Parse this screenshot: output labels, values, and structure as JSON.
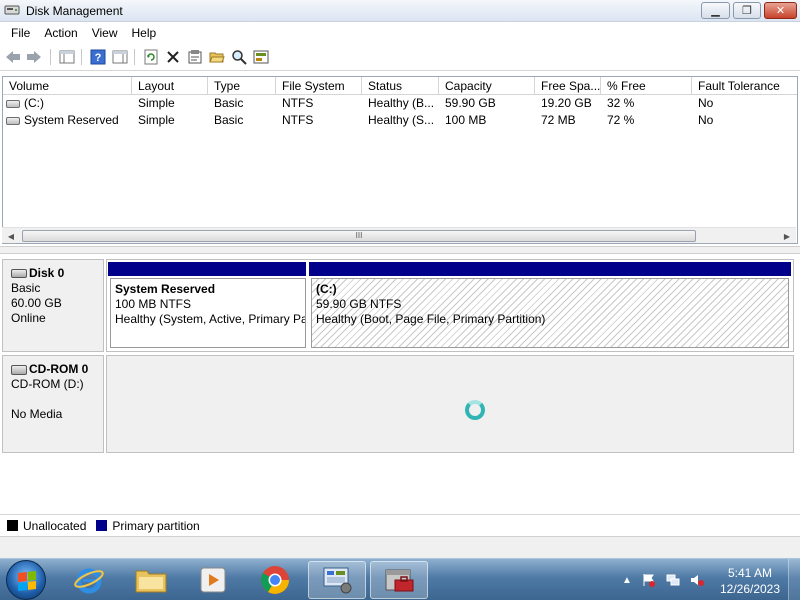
{
  "window": {
    "title": "Disk Management",
    "controls": {
      "minimize": "▁",
      "maximize": "❐",
      "close": "✕"
    }
  },
  "menu": [
    "File",
    "Action",
    "View",
    "Help"
  ],
  "toolbar": {
    "icons": [
      "back-icon",
      "forward-icon",
      "console-tree-icon",
      "help-icon",
      "action-pane-icon",
      "refresh-icon",
      "delete-icon",
      "properties-icon",
      "open-icon",
      "explore-icon",
      "rescan-icon"
    ]
  },
  "volume_list": {
    "columns": [
      "Volume",
      "Layout",
      "Type",
      "File System",
      "Status",
      "Capacity",
      "Free Spa...",
      "% Free",
      "Fault Tolerance"
    ],
    "rows": [
      [
        "(C:)",
        "Simple",
        "Basic",
        "NTFS",
        "Healthy (B...",
        "59.90 GB",
        "19.20 GB",
        "32 %",
        "No"
      ],
      [
        "System Reserved",
        "Simple",
        "Basic",
        "NTFS",
        "Healthy (S...",
        "100 MB",
        "72 MB",
        "72 %",
        "No"
      ]
    ],
    "scroll_grip": "III"
  },
  "disks": {
    "disk0": {
      "name": "Disk 0",
      "type": "Basic",
      "size": "60.00 GB",
      "state": "Online",
      "partitions": [
        {
          "name": "System Reserved",
          "size": "100 MB NTFS",
          "status": "Healthy (System, Active, Primary Pa"
        },
        {
          "name": "(C:)",
          "size": "59.90 GB NTFS",
          "status": "Healthy (Boot, Page File, Primary Partition)"
        }
      ]
    },
    "cdrom0": {
      "name": "CD-ROM 0",
      "drive": "CD-ROM (D:)",
      "media": "No Media"
    }
  },
  "legend": [
    {
      "label": "Unallocated",
      "color": "#000000"
    },
    {
      "label": "Primary partition",
      "color": "#00008b"
    }
  ],
  "taskbar": {
    "apps": [
      "internet-explorer-icon",
      "windows-explorer-icon",
      "media-player-icon",
      "chrome-icon",
      "computer-management-icon",
      "toolbox-icon"
    ],
    "tray_icons": [
      "show-hidden-icons",
      "action-center-icon",
      "network-icon",
      "volume-icon"
    ],
    "tray_arrow": "▲",
    "clock": {
      "time": "5:41 AM",
      "date": "12/26/2023"
    }
  },
  "colors": {
    "primary_partition": "#00008b",
    "taskbar": "#4f7aa6",
    "spinner": "#2fb5b3"
  }
}
